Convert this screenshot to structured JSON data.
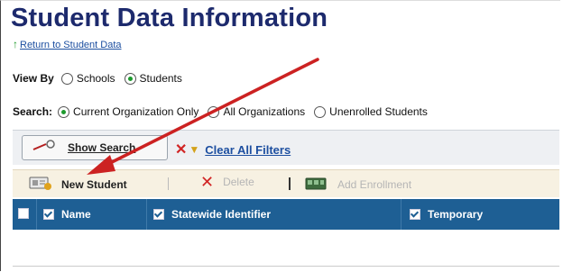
{
  "page": {
    "title": "Student Data Information",
    "return_link": "Return to Student Data"
  },
  "view_by": {
    "label": "View By",
    "options": [
      {
        "label": "Schools",
        "selected": false
      },
      {
        "label": "Students",
        "selected": true
      }
    ]
  },
  "search": {
    "label": "Search:",
    "options": [
      {
        "label": "Current Organization Only",
        "selected": true
      },
      {
        "label": "All Organizations",
        "selected": false
      },
      {
        "label": "Unenrolled Students",
        "selected": false
      }
    ]
  },
  "filter_bar": {
    "show_search": "Show Search",
    "clear_filters": "Clear All Filters"
  },
  "action_bar": {
    "new_student": "New Student",
    "delete": "Delete",
    "add_enrollment": "Add Enrollment"
  },
  "grid": {
    "columns": [
      "Name",
      "Statewide Identifier",
      "Temporary"
    ]
  },
  "colors": {
    "title": "#1d2a6d",
    "header_bg": "#1e5f94",
    "arrow": "#cc2222"
  }
}
